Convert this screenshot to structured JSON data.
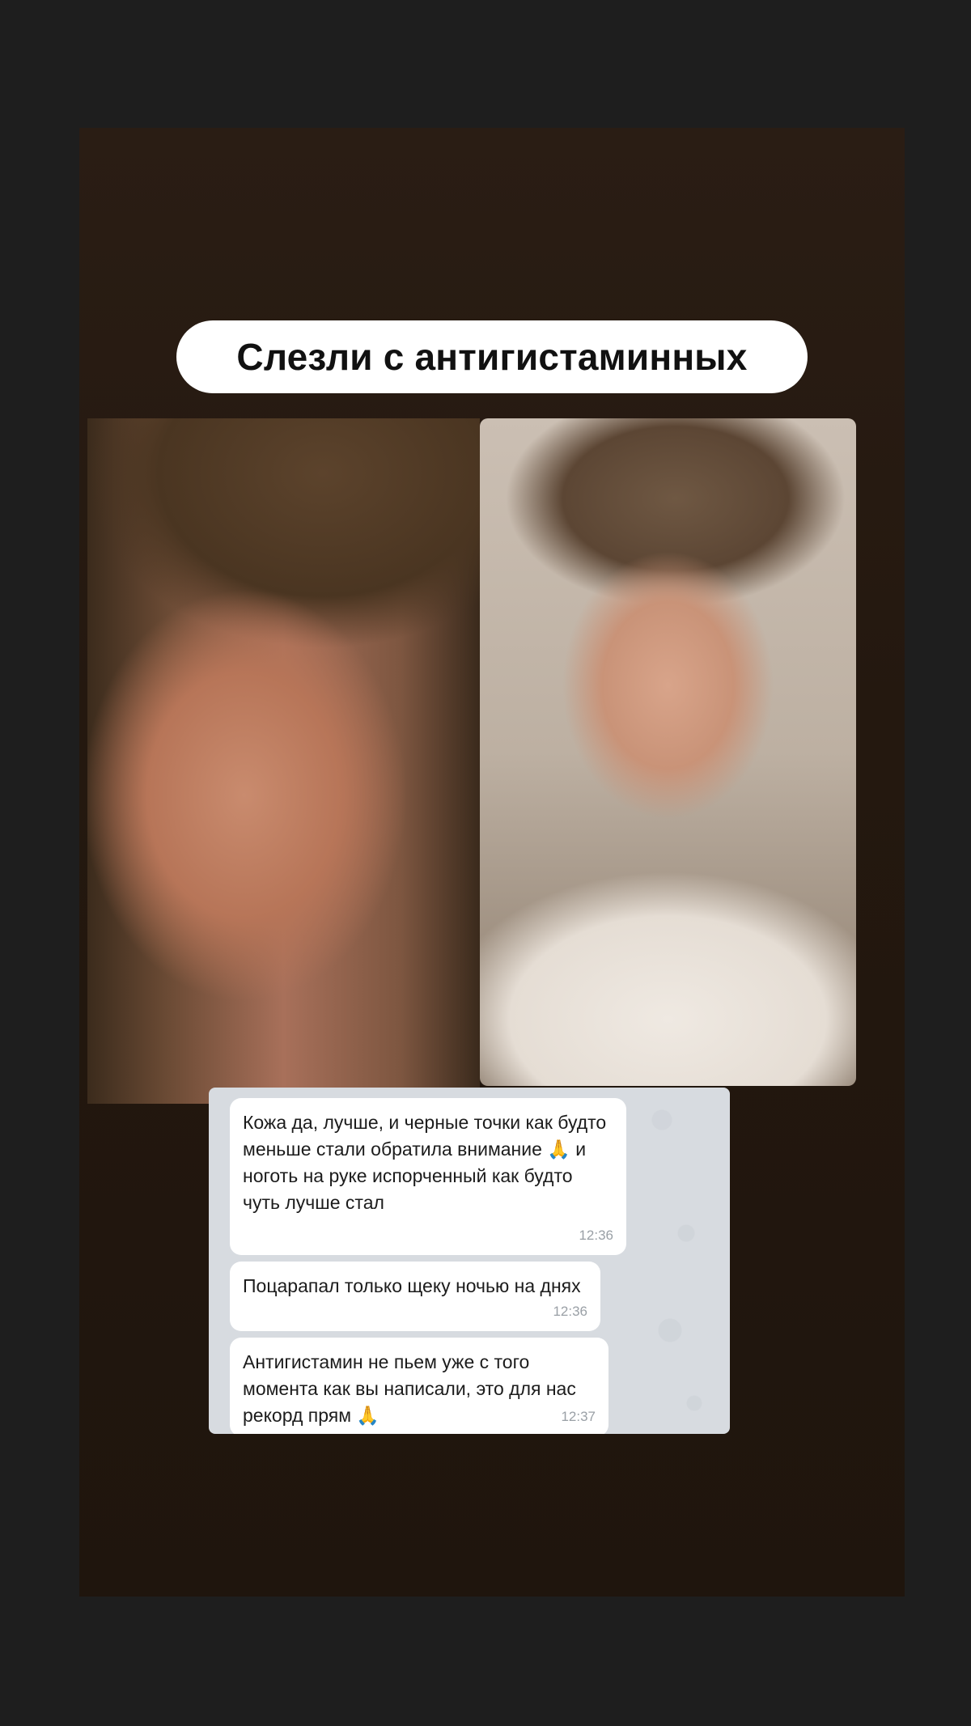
{
  "title": "Слезли с антигистаминных",
  "photos": {
    "before_label": "",
    "after_label": ""
  },
  "messages": [
    {
      "text": "Кожа да, лучше, и черные точки как будто меньше стали обратила внимание 🙏 и ноготь на руке испорченный как будто чуть лучше стал",
      "time": "12:36"
    },
    {
      "text": "Поцарапал только щеку ночью на днях",
      "time": "12:36"
    },
    {
      "text": "Антигистамин не пьем уже с того момента как вы написали, это для нас рекорд прям 🙏",
      "time": "12:37"
    }
  ],
  "colors": {
    "page_bg": "#1e1e1e",
    "story_bg": "#2a1d14",
    "pill_bg": "#ffffff",
    "chat_bg": "#d7dbe0",
    "bubble_bg": "#ffffff",
    "time_color": "#9aa0a6"
  }
}
